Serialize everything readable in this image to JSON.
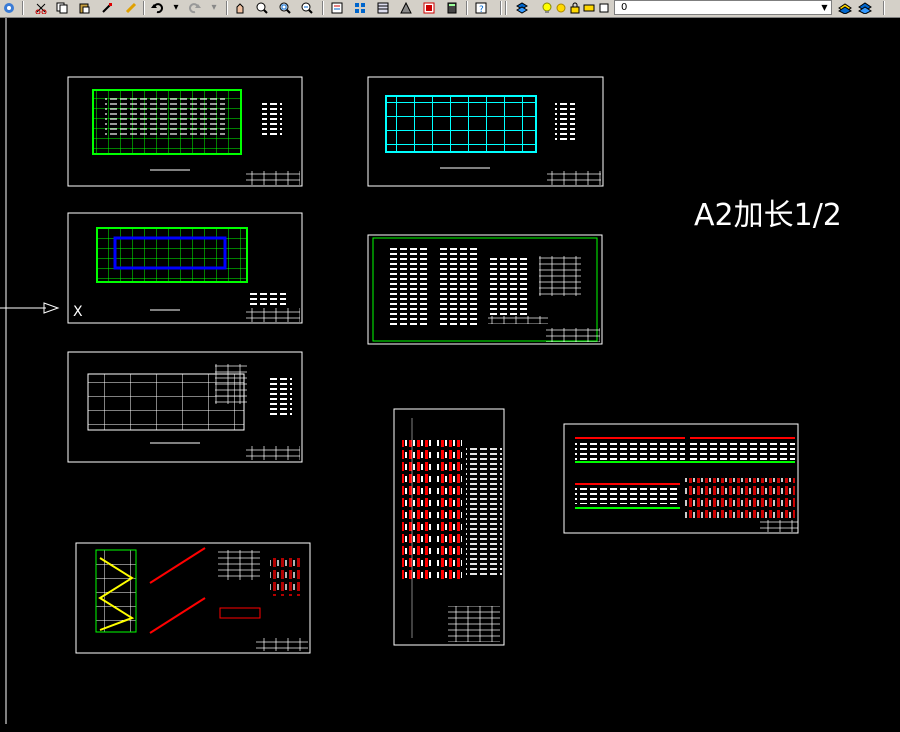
{
  "toolbar": {
    "layer_value": "0",
    "icons": [
      "layer-icon",
      "cut-icon",
      "copy-icon",
      "paste-icon",
      "match-icon",
      "pencil-icon",
      "brush-icon",
      "undo-icon",
      "undo-dropdown-icon",
      "redo-icon",
      "redo-dropdown-icon",
      "pan-icon",
      "zoom-realtime-icon",
      "zoom-window-icon",
      "zoom-previous-icon",
      "properties-icon",
      "design-center-icon",
      "tool-palette-icon",
      "markup-icon",
      "calculator-icon",
      "help-icon",
      "layer-manager-icon",
      "lightbulb-icon",
      "sun-icon",
      "lock-icon",
      "color-swatch-icon",
      "layer-previous-icon",
      "layer-state-icon"
    ]
  },
  "canvas": {
    "annotation_text": "A2加长1/2",
    "ucs_label": "X",
    "colors": {
      "background": "#000000",
      "frame": "#ffffff",
      "green": "#00ff00",
      "cyan": "#00ffff",
      "red": "#ff0000",
      "blue": "#0000ff"
    }
  },
  "statusbar": {
    "text": ""
  }
}
